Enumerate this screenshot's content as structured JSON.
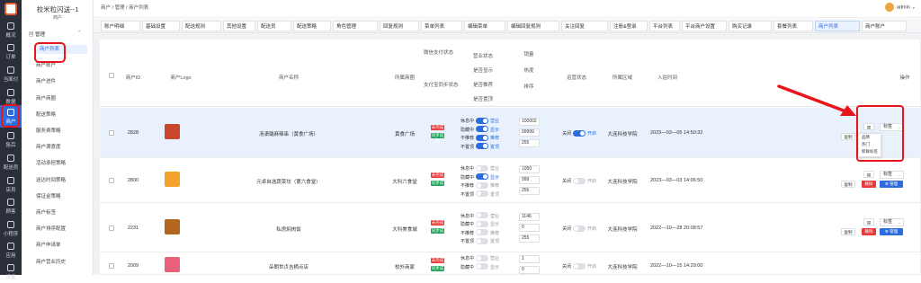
{
  "app": {
    "title": "校米粒闪送--1",
    "subtitle": "商户"
  },
  "rail": [
    {
      "label": "概况",
      "icon": "dashboard-icon"
    },
    {
      "label": "订单",
      "icon": "order-icon"
    },
    {
      "label": "当面付",
      "icon": "pay-icon"
    },
    {
      "label": "数据",
      "icon": "data-icon"
    },
    {
      "label": "商户",
      "icon": "shop-icon",
      "active": true
    },
    {
      "label": "售后",
      "icon": "headset-icon"
    },
    {
      "label": "配送员",
      "icon": "rider-icon"
    },
    {
      "label": "店员",
      "icon": "staff-icon"
    },
    {
      "label": "顾客",
      "icon": "customer-icon"
    },
    {
      "label": "小程序",
      "icon": "miniapp-icon"
    },
    {
      "label": "应用",
      "icon": "apps-icon"
    },
    {
      "label": "设置",
      "icon": "settings-icon"
    }
  ],
  "side": {
    "group": "管理",
    "collapse": "⌃",
    "items": [
      "商户列表",
      "商户账户",
      "商户进件",
      "商户商圈",
      "配送策略",
      "服务费策略",
      "商户满意度",
      "活动承担策略",
      "送达时间策略",
      "保证金策略",
      "商户标签",
      "商户排序配置",
      "商户申请单",
      "商户营业历史"
    ]
  },
  "top": {
    "crumb": "商户  /  管理  /  商户列表",
    "user": "admin",
    "caret": "⌄"
  },
  "tabs": [
    "账户明细",
    "基础设置",
    "配送规则",
    "其他设置",
    "配送员",
    "配送策略",
    "角色管理",
    "回复规则",
    "菜单列表",
    "编辑菜单",
    "编辑回复规则",
    "关注回复",
    "注册&登录",
    "平台列表",
    "平台商户设置",
    "购买记录",
    "套餐列表",
    "商户列表",
    "商户账户"
  ],
  "table": {
    "headers": {
      "id": "商户ID",
      "logo": "商户Logo",
      "name": "商户名称",
      "area": "所属商圈",
      "wechat_pay": "微信支付状态",
      "alipay": "支付宝同步状态",
      "biz": [
        "营业状态",
        "是否显示",
        "是否推荐",
        "是否置顶"
      ],
      "stock": [
        "销量",
        "热度",
        "排序"
      ],
      "ops_state": "运营状态",
      "region": "所属区域",
      "joined": "入驻时间",
      "actions": "操作"
    },
    "rows": [
      {
        "id": "2828",
        "name": "汤潇璐麻辣串（黄食广场）",
        "area": "黄食广场",
        "tag_red": "未完成",
        "tag_green": "同步成功",
        "toggles": [
          [
            "休息中",
            "营业",
            true
          ],
          [
            "隐藏中",
            "显示",
            true
          ],
          [
            "不推荐",
            "推荐",
            true
          ],
          [
            "不置顶",
            "置顶",
            true
          ]
        ],
        "nums": [
          "100002",
          "99999",
          "255"
        ],
        "ops": [
          "关闭",
          "开启"
        ],
        "region": "大连科技学院",
        "joined": "2023—03—05 14:50:32",
        "selected": true,
        "logo_color": "#c8452e"
      },
      {
        "id": "2800",
        "name": "元卓自选蔬菜坊（第六食堂）",
        "area": "大科六食堂",
        "tag_red": "未完成",
        "tag_green": "同步成功",
        "toggles": [
          [
            "休息中",
            "营业",
            false
          ],
          [
            "隐藏中",
            "显示",
            true
          ],
          [
            "不推荐",
            "推荐",
            false
          ],
          [
            "不置顶",
            "置顶",
            false
          ]
        ],
        "nums": [
          "1050",
          "999",
          "255"
        ],
        "ops": [
          "关闭",
          "开启"
        ],
        "region": "大连科技学院",
        "joined": "2023—03—03 14:06:50",
        "selected": false,
        "logo_color": "#f4a12e"
      },
      {
        "id": "2231",
        "name": "私房焖肉饭",
        "area": "大科美食城",
        "tag_red": "未完成",
        "tag_green": "同步成功",
        "toggles": [
          [
            "休息中",
            "营业",
            false
          ],
          [
            "隐藏中",
            "显示",
            false
          ],
          [
            "不推荐",
            "推荐",
            false
          ],
          [
            "不置顶",
            "置顶",
            false
          ]
        ],
        "nums": [
          "1146",
          "0",
          "255"
        ],
        "ops": [
          "关闭",
          "开启"
        ],
        "region": "大连科技学院",
        "joined": "2022—10—28 20:08:57",
        "selected": false,
        "logo_color": "#b5651d"
      },
      {
        "id": "2009",
        "name": "朵朗世贞吉栖点店",
        "area": "校外商家",
        "tag_red": "未完成",
        "tag_green": "同步成功",
        "toggles": [
          [
            "休息中",
            "营业",
            false
          ],
          [
            "隐藏中",
            "显示",
            false
          ]
        ],
        "nums": [
          "1",
          "0"
        ],
        "ops": [
          "关闭",
          "开启"
        ],
        "region": "大连科技学院",
        "joined": "2022—10—15 14:29:00",
        "selected": false,
        "logo_color": "#e8607a"
      }
    ],
    "actions": {
      "copy": "复制",
      "delete": "删除",
      "manage": "管理",
      "label_select": "标签",
      "caret": "⌄"
    },
    "dropdown": [
      "品牌",
      "热门",
      "新鲜标签"
    ]
  },
  "colors": {
    "accent": "#2d6cdf",
    "danger": "#e6393a",
    "success": "#1fa25a",
    "annotation": "#e8151b"
  }
}
